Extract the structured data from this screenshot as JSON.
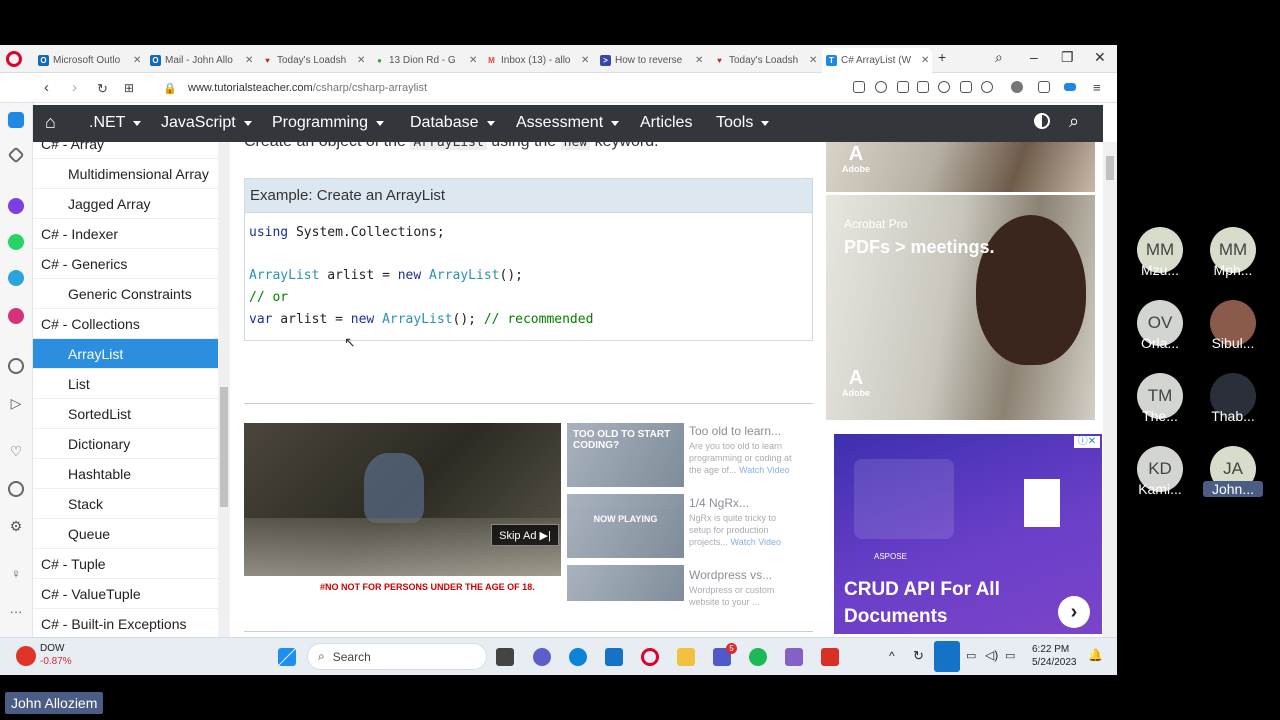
{
  "browser": {
    "tabs": [
      {
        "label": "Microsoft Outlo",
        "color": "#0f6cbd",
        "glyph": "O"
      },
      {
        "label": "Mail - John Allo",
        "color": "#0f6cbd",
        "glyph": "O"
      },
      {
        "label": "Today's Loadsh",
        "color": "#c62828",
        "glyph": "♥"
      },
      {
        "label": "13 Dion Rd - G",
        "color": "#34a853",
        "glyph": "●"
      },
      {
        "label": "Inbox (13) - allo",
        "color": "#ea4335",
        "glyph": "M"
      },
      {
        "label": "How to reverse",
        "color": "#3949ab",
        "glyph": ">"
      },
      {
        "label": "Today's Loadsh",
        "color": "#c62828",
        "glyph": "♥"
      },
      {
        "label": "C# ArrayList (W",
        "color": "#1e88e5",
        "glyph": "T"
      }
    ],
    "new_tab": "+",
    "url_host": "www.tutorialsteacher.com",
    "url_path": "/csharp/csharp-arraylist"
  },
  "site_nav": {
    "items": [
      ".NET",
      "JavaScript",
      "Programming",
      "Database",
      "Assessment",
      "Articles",
      "Tools"
    ]
  },
  "left_menu": {
    "items": [
      {
        "label": "C# - Array",
        "level": 1
      },
      {
        "label": "Multidimensional Array",
        "level": 2
      },
      {
        "label": "Jagged Array",
        "level": 2
      },
      {
        "label": "C# - Indexer",
        "level": 1
      },
      {
        "label": "C# - Generics",
        "level": 1
      },
      {
        "label": "Generic Constraints",
        "level": 2
      },
      {
        "label": "C# - Collections",
        "level": 1
      },
      {
        "label": "ArrayList",
        "level": 2,
        "active": true
      },
      {
        "label": "List",
        "level": 2
      },
      {
        "label": "SortedList",
        "level": 2
      },
      {
        "label": "Dictionary",
        "level": 2
      },
      {
        "label": "Hashtable",
        "level": 2
      },
      {
        "label": "Stack",
        "level": 2
      },
      {
        "label": "Queue",
        "level": 2
      },
      {
        "label": "C# - Tuple",
        "level": 1
      },
      {
        "label": "C# - ValueTuple",
        "level": 1
      },
      {
        "label": "C# - Built-in Exceptions",
        "level": 1
      }
    ]
  },
  "content": {
    "intro_before": "Create an object of the",
    "intro_code1": "ArrayList",
    "intro_mid": "using the",
    "intro_code2": "new",
    "intro_after": "keyword.",
    "example_title": "Example: Create an ArrayList",
    "code": {
      "line1_kw": "using",
      "line1_rest": " System.Collections;",
      "line2_type": "ArrayList",
      "line2_mid": " arlist = ",
      "line2_kw": "new",
      "line2_type2": " ArrayList",
      "line2_end": "();",
      "line3_comment": "// or",
      "line4_kw": "var",
      "line4_mid": " arlist = ",
      "line4_kw2": "new",
      "line4_type": " ArrayList",
      "line4_end": "(); ",
      "line4_comment": "// recommended"
    },
    "video": {
      "skip_label": "Skip Ad ▶|",
      "caption": "#NO  NOT FOR PERSONS UNDER THE AGE OF 18."
    },
    "related": [
      {
        "thumb": "TOO OLD TO START CODING?",
        "title": "Too old to learn...",
        "desc": "Are you too old to learn programming or coding at the age of...",
        "link": "Watch Video"
      },
      {
        "thumb": "NOW PLAYING",
        "title": "1/4 NgRx...",
        "desc": "NgRx is quite tricky to setup for production projects...",
        "link": "Watch Video"
      },
      {
        "thumb": "",
        "title": "Wordpress vs...",
        "desc": "Wordpress or custom website to your ...",
        "link": ""
      }
    ]
  },
  "ads": {
    "adobe_label": "Adobe",
    "acrobat_label": "Acrobat Pro",
    "acrobat_headline": "PDFs > meetings.",
    "aspose_brand": "ASPOSE",
    "aspose_headline_1": "CRUD API For All",
    "aspose_headline_2": "Documents"
  },
  "taskbar": {
    "stock_name": "DOW",
    "stock_change": "-0.87%",
    "search_label": "Search",
    "time": "6:22 PM",
    "date": "5/24/2023",
    "teams_badge": "5"
  },
  "participants": [
    {
      "initials": "MM",
      "name": "Mzu..."
    },
    {
      "initials": "MM",
      "name": "Mph..."
    },
    {
      "initials": "OV",
      "name": "Orla..."
    },
    {
      "initials": "",
      "name": "Sibul..."
    },
    {
      "initials": "TM",
      "name": "The..."
    },
    {
      "initials": "",
      "name": "Thab..."
    },
    {
      "initials": "KD",
      "name": "Kami..."
    },
    {
      "initials": "JA",
      "name": "John..."
    }
  ],
  "presenter_name": "John Alloziem",
  "colors": {
    "nav_bg": "#33363a",
    "active_menu": "#2b8ede",
    "example_header": "#dce7f0"
  }
}
